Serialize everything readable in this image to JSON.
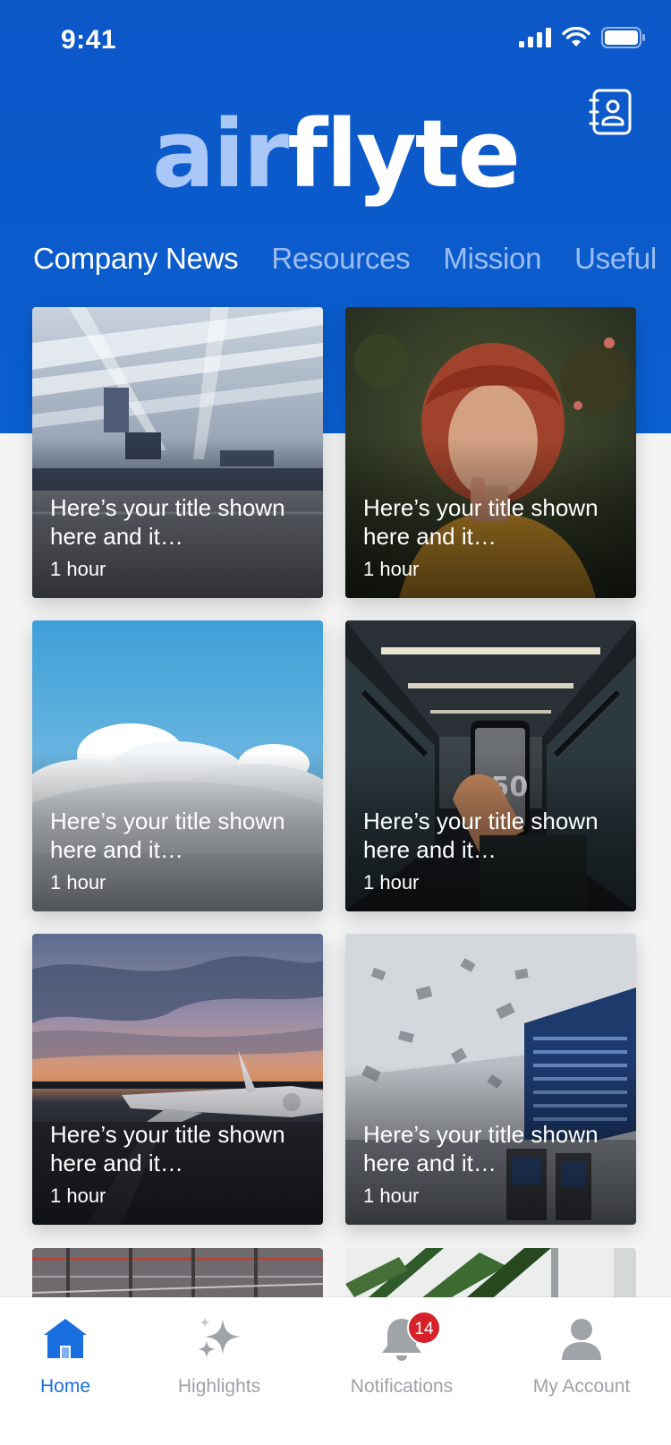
{
  "status_bar": {
    "time": "9:41"
  },
  "header": {
    "logo_part_a": "air",
    "logo_part_b": "flyte",
    "contacts_icon": "contact-book-icon"
  },
  "tabs": [
    {
      "label": "Company News",
      "active": true
    },
    {
      "label": "Resources",
      "active": false
    },
    {
      "label": "Mission",
      "active": false
    },
    {
      "label": "Useful",
      "active": false
    }
  ],
  "cards": [
    {
      "title": "Here’s your title shown here and it…",
      "time": "1 hour",
      "image": "airport-terminal-roof"
    },
    {
      "title": "Here’s your title shown here and it…",
      "time": "1 hour",
      "image": "red-haired-woman-portrait"
    },
    {
      "title": "Here’s your title shown here and it…",
      "time": "1 hour",
      "image": "clouds-blue-sky"
    },
    {
      "title": "Here’s your title shown here and it…",
      "time": "1 hour",
      "image": "phone-in-jet-bridge"
    },
    {
      "title": "Here’s your title shown here and it…",
      "time": "1 hour",
      "image": "plane-at-sunset"
    },
    {
      "title": "Here’s your title shown here and it…",
      "time": "1 hour",
      "image": "terminal-flight-boards"
    }
  ],
  "tabbar": {
    "home": "Home",
    "highlights": "Highlights",
    "notifications": "Notifications",
    "notifications_badge": "14",
    "account": "My Account"
  },
  "colors": {
    "brand_blue": "#0b5acb",
    "active_tab": "#1a6fe0",
    "badge_red": "#d6202a",
    "logo_light": "#a9c8f7"
  }
}
